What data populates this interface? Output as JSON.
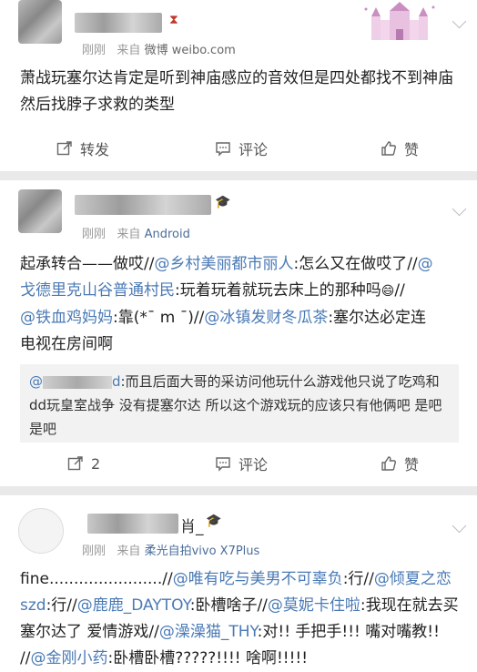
{
  "post1": {
    "meta_time": "刚刚",
    "meta_from": "来自",
    "meta_source": "微博 weibo.com",
    "text": "萧战玩塞尔达肯定是听到神庙感应的音效但是四处都找不到神庙 然后找脖子求救的类型",
    "repost_label": "转发",
    "comment_label": "评论",
    "like_label": "赞"
  },
  "post2": {
    "meta_time": "刚刚",
    "meta_from": "来自",
    "meta_source": "Android",
    "line1_a": "起承转合——做哎//",
    "mention1": "@乡村美丽都市丽人",
    "line1_b": ":怎么又在做哎了//",
    "mention2_a": "@",
    "mention2_b": "戈德里克山谷普通村民",
    "line2_b": ":玩着玩着就玩去床上的那种吗",
    "line2_c": "//",
    "mention3": "@铁血鸡妈妈",
    "line3_b": ":靠(*¯ m ¯)//",
    "mention4": "@冰镇发财冬瓜茶",
    "line3_c": ":塞尔达必定连",
    "line4": "电视在房间啊",
    "quote_at": "@",
    "quote_d": "d",
    "quote_text": ":而且后面大哥的采访问他玩什么游戏他只说了吃鸡和dd玩皇室战争 没有提塞尔达 所以这个游戏玩的应该只有他俩吧 是吧是吧",
    "repost_count": "2",
    "comment_label": "评论",
    "like_label": "赞"
  },
  "post3": {
    "name_suffix": "肖_",
    "meta_time": "刚刚",
    "meta_from": "来自",
    "meta_source": "柔光自拍vivo X7Plus",
    "t1": "fine.......................//",
    "m1": "@唯有吃与美男不可辜负",
    "t2": ":行//",
    "m2": "@倾夏之恋szd",
    "t3": ":行//",
    "m3": "@鹿鹿_DAYTOY",
    "t4": ":卧槽啥子//",
    "m4": "@莫妮卡住啦",
    "t5": ":我现在就去买塞尔达了 爱情游戏//",
    "m5": "@澡澡猫_THY",
    "t6": ":对!! 手把手!!! 嘴对嘴教!! //",
    "m6": "@金刚小药",
    "t7": ":卧槽卧槽?????!!!! 啥啊!!!!!"
  },
  "colors": {
    "link": "#4a7ab5",
    "background": "#e9e9e9"
  }
}
